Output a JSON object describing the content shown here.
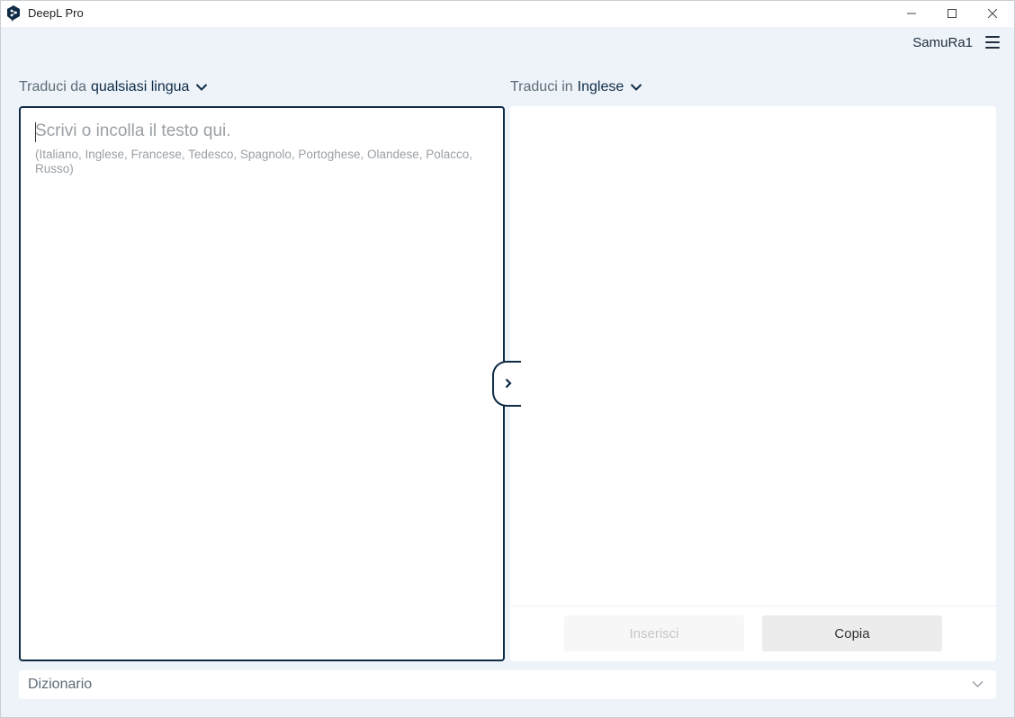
{
  "window": {
    "title": "DeepL Pro",
    "logo_icon": "deepl-logo-icon",
    "controls": [
      "minimize-icon",
      "maximize-icon",
      "close-icon"
    ]
  },
  "user": {
    "name": "SamuRa1",
    "menu_icon": "hamburger-menu-icon"
  },
  "source": {
    "prefix": "Traduci da",
    "language": "qualsiasi lingua",
    "placeholder": "Scrivi o incolla il testo qui.",
    "languages_hint": "(Italiano, Inglese, Francese, Tedesco, Spagnolo, Portoghese, Olandese, Polacco, Russo)"
  },
  "target": {
    "prefix": "Traduci in",
    "language": "Inglese",
    "insert_label": "Inserisci",
    "copy_label": "Copia"
  },
  "dictionary": {
    "label": "Dizionario"
  },
  "colors": {
    "background": "#edf3f9",
    "accent": "#0f2b46",
    "panel": "#ffffff"
  }
}
